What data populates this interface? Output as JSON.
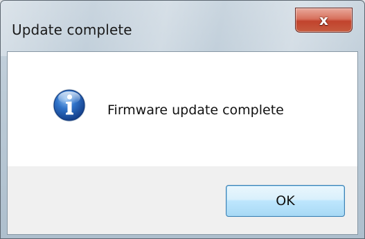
{
  "window": {
    "title": "Update complete",
    "close_glyph": "x"
  },
  "dialog": {
    "icon": "info-icon",
    "message": "Firmware update complete",
    "ok_label": "OK"
  },
  "colors": {
    "close_button": "#c1432d",
    "ok_button": "#a7d9f5",
    "icon_blue": "#1f5fb4"
  }
}
